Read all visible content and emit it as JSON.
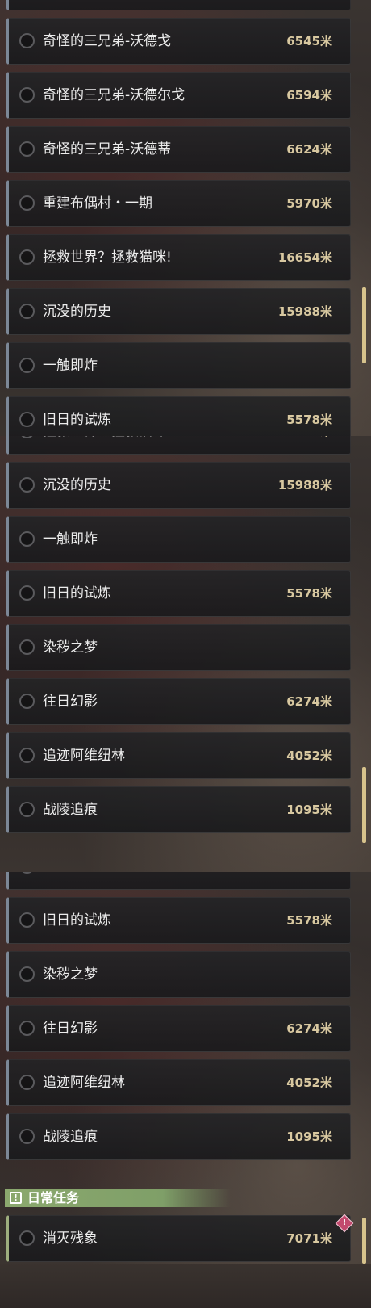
{
  "panel_a": {
    "rows": [
      {
        "name": "",
        "dist": ""
      },
      {
        "name": "奇怪的三兄弟-沃德戈",
        "dist": "6545米"
      },
      {
        "name": "奇怪的三兄弟-沃德尔戈",
        "dist": "6594米"
      },
      {
        "name": "奇怪的三兄弟-沃德蒂",
        "dist": "6624米"
      },
      {
        "name": "重建布偶村・一期",
        "dist": "5970米"
      },
      {
        "name": "拯救世界？拯救猫咪!",
        "dist": "16654米"
      },
      {
        "name": "沉没的历史",
        "dist": "15988米"
      },
      {
        "name": "一触即炸",
        "dist": ""
      },
      {
        "name": "旧日的试炼",
        "dist": "5578米"
      }
    ]
  },
  "panel_b": {
    "rows": [
      {
        "name": "拯救世界？拯救猫咪!",
        "dist": "16654米"
      },
      {
        "name": "沉没的历史",
        "dist": "15988米"
      },
      {
        "name": "一触即炸",
        "dist": ""
      },
      {
        "name": "旧日的试炼",
        "dist": "5578米"
      },
      {
        "name": "染秽之梦",
        "dist": ""
      },
      {
        "name": "往日幻影",
        "dist": "6274米"
      },
      {
        "name": "追迹阿维纽林",
        "dist": "4052米"
      },
      {
        "name": "战陵追痕",
        "dist": "1095米"
      }
    ]
  },
  "panel_c": {
    "rows": [
      {
        "name": "一触即炸",
        "dist": ""
      },
      {
        "name": "旧日的试炼",
        "dist": "5578米"
      },
      {
        "name": "染秽之梦",
        "dist": ""
      },
      {
        "name": "往日幻影",
        "dist": "6274米"
      },
      {
        "name": "追迹阿维纽林",
        "dist": "4052米"
      },
      {
        "name": "战陵追痕",
        "dist": "1095米"
      }
    ],
    "section": {
      "icon": "exclamation-box-icon",
      "title": "日常任务",
      "color": "#8ba86e"
    },
    "daily_rows": [
      {
        "name": "消灭残象",
        "dist": "7071米",
        "badge": "!"
      }
    ]
  },
  "colors": {
    "distance": "#d8c8a0",
    "scrollbar": "#d7c38c",
    "row_accent": "#7c8796",
    "alert": "#c24a6e"
  },
  "icons": {
    "row_status": "empty-circle-icon",
    "alert": "alert-diamond-icon"
  }
}
